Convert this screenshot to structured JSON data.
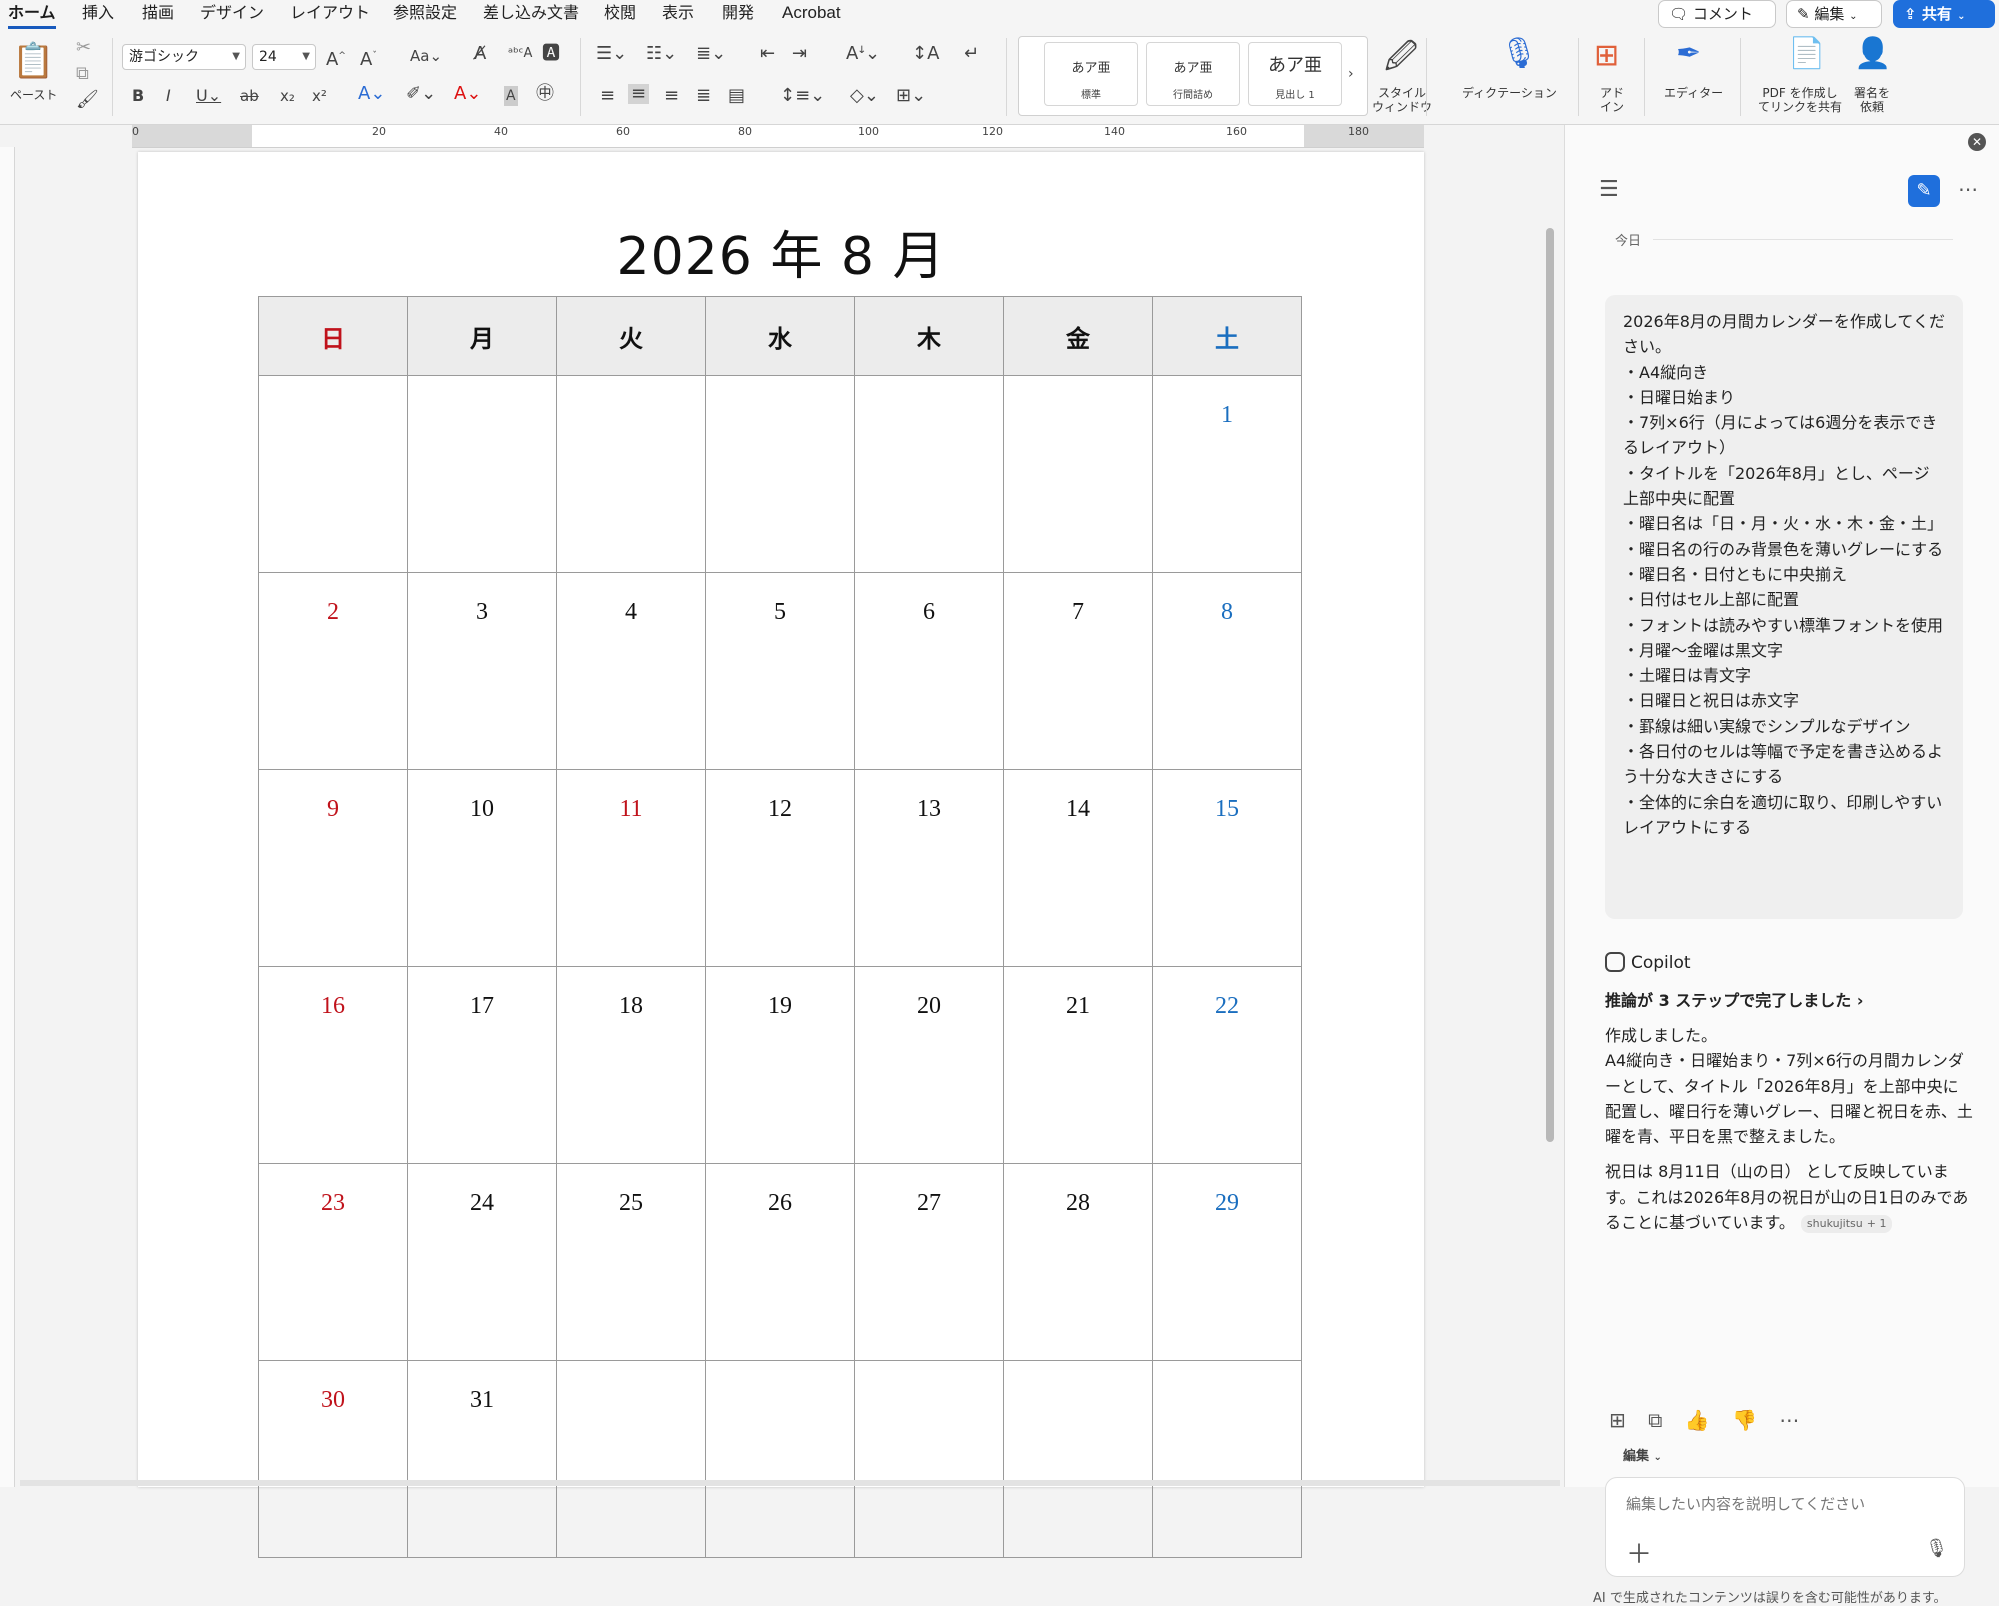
{
  "menu": {
    "tabs": [
      "ホーム",
      "挿入",
      "描画",
      "デザイン",
      "レイアウト",
      "参照設定",
      "差し込み文書",
      "校閲",
      "表示",
      "開発",
      "Acrobat"
    ],
    "comment_label": "コメント",
    "edit_label": "編集",
    "share_label": "共有"
  },
  "ribbon": {
    "paste_label": "ペースト",
    "font_name": "游ゴシック",
    "font_size": "24",
    "styles": [
      {
        "sample": "あア亜",
        "caption": "標準"
      },
      {
        "sample": "あア亜",
        "caption": "行間詰め"
      },
      {
        "sample": "あア亜",
        "caption": "見出し 1"
      }
    ],
    "style_window_label": "スタイル\nウィンドウ",
    "dictation_label": "ディクテーション",
    "addin_label": "アド\nイン",
    "editor_label": "エディター",
    "pdf_label": "PDF を作成し\nてリンクを共有",
    "sign_label": "署名を\n依頼",
    "accent_color": "#185abd"
  },
  "ruler": {
    "labels": [
      "0",
      "20",
      "40",
      "60",
      "80",
      "100",
      "120",
      "140",
      "160",
      "180"
    ]
  },
  "document": {
    "title": "2026 年 8 月",
    "weekdays": [
      {
        "label": "日",
        "kind": "sun"
      },
      {
        "label": "月",
        "kind": ""
      },
      {
        "label": "火",
        "kind": ""
      },
      {
        "label": "水",
        "kind": ""
      },
      {
        "label": "木",
        "kind": ""
      },
      {
        "label": "金",
        "kind": ""
      },
      {
        "label": "土",
        "kind": "sat"
      }
    ],
    "weeks": [
      [
        "",
        "",
        "",
        "",
        "",
        "",
        "1"
      ],
      [
        "2",
        "3",
        "4",
        "5",
        "6",
        "7",
        "8"
      ],
      [
        "9",
        "10",
        "11",
        "12",
        "13",
        "14",
        "15"
      ],
      [
        "16",
        "17",
        "18",
        "19",
        "20",
        "21",
        "22"
      ],
      [
        "23",
        "24",
        "25",
        "26",
        "27",
        "28",
        "29"
      ],
      [
        "30",
        "31",
        "",
        "",
        "",
        "",
        ""
      ]
    ],
    "holidays": [
      "11"
    ],
    "colors": {
      "sunday": "#c0121b",
      "saturday": "#1a6ebf",
      "holiday": "#c0121b",
      "header_bg": "#ececec"
    }
  },
  "copilot": {
    "today_label": "今日",
    "user_message_lines": [
      "2026年8月の月間カレンダーを作成してください。",
      "・A4縦向き",
      "・日曜日始まり",
      "・7列×6行（月によっては6週分を表示できるレイアウト）",
      "・タイトルを「2026年8月」とし、ページ上部中央に配置",
      "・曜日名は「日・月・火・水・木・金・土」",
      "・曜日名の行のみ背景色を薄いグレーにする",
      "・曜日名・日付ともに中央揃え",
      "・日付はセル上部に配置",
      "・フォントは読みやすい標準フォントを使用",
      "・月曜〜金曜は黒文字",
      "・土曜日は青文字",
      "・日曜日と祝日は赤文字",
      "・罫線は細い実線でシンプルなデザイン",
      "・各日付のセルは等幅で予定を書き込めるよう十分な大きさにする",
      "・全体的に余白を適切に取り、印刷しやすいレイアウトにする"
    ],
    "assistant_name": "Copilot",
    "reasoning_label": "推論が 3 ステップで完了しました",
    "answer_paragraphs": [
      "作成しました。\nA4縦向き・日曜始まり・7列×6行の月間カレンダーとして、タイトル「2026年8月」を上部中央に配置し、曜日行を薄いグレー、日曜と祝日を赤、土曜を青、平日を黒で整えました。",
      "祝日は 8月11日（山の日） として反映しています。これは2026年8月の祝日が山の日1日のみであることに基づいています。"
    ],
    "citation_label": "shukujitsu",
    "citation_count": "+ 1",
    "edit_mode_label": "編集",
    "input_placeholder": "編集したい内容を説明してください",
    "disclaimer": "AI で生成されたコンテンツは誤りを含む可能性があります。"
  }
}
